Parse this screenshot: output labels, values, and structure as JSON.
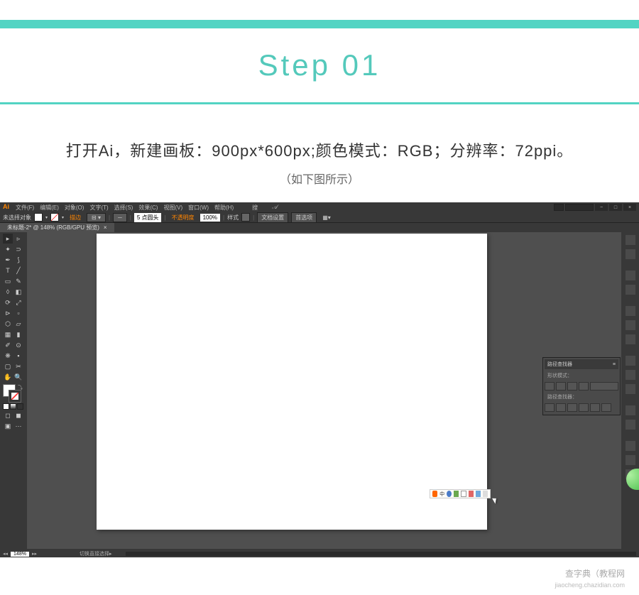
{
  "header": {
    "step_title": "Step 01"
  },
  "instruction": {
    "main": "打开Ai，新建画板：900px*600px;颜色模式：RGB；分辨率：72ppi。",
    "sub": "（如下图所示）"
  },
  "ai": {
    "logo": "Ai",
    "menu": {
      "file": "文件(F)",
      "edit": "编辑(E)",
      "object": "对象(O)",
      "type": "文字(T)",
      "select": "选择(S)",
      "effect": "效果(C)",
      "view": "视图(V)",
      "window": "窗口(W)",
      "help": "帮助(H)"
    },
    "search_label": "搜",
    "control": {
      "no_selection": "未选择对象",
      "stroke_label": "描边",
      "stroke_val": "5 点圆头",
      "opacity_label": "不透明度",
      "opacity_val": "100%",
      "style_label": "样式",
      "doc_setup": "文档设置",
      "preferences": "首选项"
    },
    "tab": "未标题-2* @ 148% (RGB/GPU 预览)",
    "panel": {
      "pathfinder_title": "路径查找器",
      "shape_mode": "形状模式：",
      "pathfinder_label": "路径查找器："
    },
    "status": {
      "zoom": "148%",
      "tool": "切换直接选择"
    }
  },
  "floating_toolbar": {
    "text": "中"
  },
  "watermark": {
    "main": "查字典（教程网",
    "sub": "jiaocheng.chazidian.com"
  }
}
